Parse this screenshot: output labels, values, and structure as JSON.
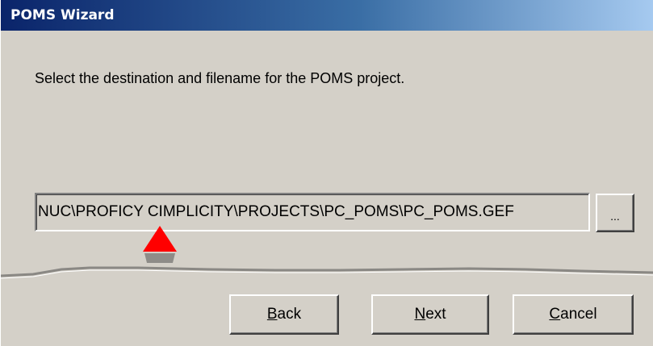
{
  "window": {
    "title": "POMS Wizard"
  },
  "page": {
    "prompt": "Select the destination and filename for the POMS project."
  },
  "path_field": {
    "value": "NUC\\PROFICY CIMPLICITY\\PROJECTS\\PC_POMS\\PC_POMS.GEF"
  },
  "browse_button": {
    "label": "..."
  },
  "buttons": {
    "back": {
      "mnemonic": "B",
      "rest": "ack"
    },
    "next": {
      "mnemonic": "N",
      "rest": "ext"
    },
    "cancel": {
      "mnemonic": "C",
      "rest": "ancel"
    }
  },
  "colors": {
    "title_start": "#0a246a",
    "title_end": "#a6caf0",
    "face": "#d4d0c8",
    "annotation_arrow": "#ff0000"
  },
  "icons": [
    "annotation-arrow-icon"
  ]
}
